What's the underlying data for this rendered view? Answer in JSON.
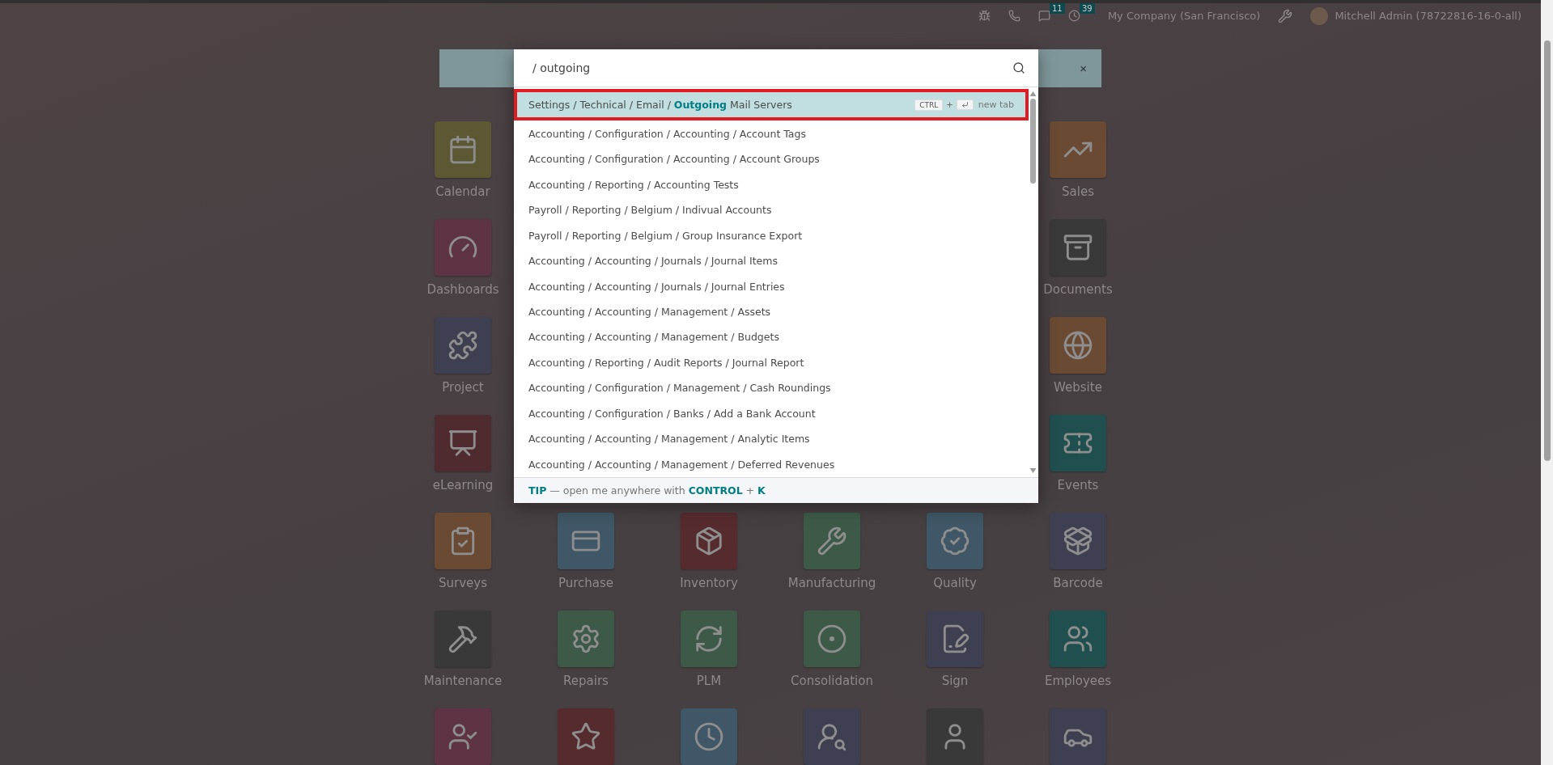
{
  "topbar": {
    "badges": [
      {
        "kind": "chat",
        "count": "11"
      },
      {
        "kind": "activity",
        "count": "39"
      }
    ],
    "company": "My Company (San Francisco)",
    "user": "Mitchell Admin (78722816-16-0-all)"
  },
  "banner": {
    "close": "×"
  },
  "app_rows": [
    [
      {
        "label": "Calendar",
        "kind": "calendar",
        "color": "#5d5834"
      },
      {
        "label": "Sales",
        "kind": "sales",
        "color": "#6b4a33"
      }
    ],
    [
      {
        "label": "Dashboards",
        "kind": "dashboards",
        "color": "#5e3343"
      },
      {
        "label": "Documents",
        "kind": "documents",
        "color": "#393939"
      }
    ],
    [
      {
        "label": "Project",
        "kind": "project",
        "color": "#3f3f52"
      },
      {
        "label": "Website",
        "kind": "website",
        "color": "#6b4a33"
      }
    ],
    [
      {
        "label": "eLearning",
        "kind": "elearning",
        "color": "#4f2a2e"
      },
      {
        "label": "Events",
        "kind": "events",
        "color": "#1f4f4f"
      }
    ],
    [
      {
        "label": "Surveys",
        "kind": "surveys",
        "color": "#6b4a33"
      },
      {
        "label": "Purchase",
        "kind": "purchase",
        "color": "#3f5766"
      },
      {
        "label": "Inventory",
        "kind": "inventory",
        "color": "#562b2e"
      },
      {
        "label": "Manufacturing",
        "kind": "manufacturing",
        "color": "#3d5a48"
      },
      {
        "label": "Quality",
        "kind": "quality",
        "color": "#3f5766"
      },
      {
        "label": "Barcode",
        "kind": "barcode",
        "color": "#3f3f52"
      }
    ],
    [
      {
        "label": "Maintenance",
        "kind": "maintenance",
        "color": "#393939"
      },
      {
        "label": "Repairs",
        "kind": "repairs",
        "color": "#3d5a48"
      },
      {
        "label": "PLM",
        "kind": "plm",
        "color": "#3d5a48"
      },
      {
        "label": "Consolidation",
        "kind": "consolidation",
        "color": "#3d5a48"
      },
      {
        "label": "Sign",
        "kind": "sign",
        "color": "#3f3f52"
      },
      {
        "label": "Employees",
        "kind": "employees",
        "color": "#1f4f4f"
      }
    ],
    [
      {
        "kind": "payroll",
        "color": "#5e3343"
      },
      {
        "kind": "appraisal",
        "color": "#562b2e"
      },
      {
        "kind": "attendance",
        "color": "#3f5766"
      },
      {
        "kind": "recruitment",
        "color": "#3f3f52"
      },
      {
        "kind": "referral",
        "color": "#393939"
      },
      {
        "kind": "fleet",
        "color": "#3f3f52"
      }
    ]
  ],
  "palette": {
    "search_value": "/ outgoing",
    "results": [
      {
        "text": "Settings / Technical / Email / **Outgoing** Mail Servers",
        "selected": true
      },
      {
        "text": "Accounting / Configuration / Accounting / Account Tags",
        "selected": false
      },
      {
        "text": "Accounting / Configuration / Accounting / Account Groups",
        "selected": false
      },
      {
        "text": "Accounting / Reporting / Accounting Tests",
        "selected": false
      },
      {
        "text": "Payroll / Reporting / Belgium / Indivual Accounts",
        "selected": false
      },
      {
        "text": "Payroll / Reporting / Belgium / Group Insurance Export",
        "selected": false
      },
      {
        "text": "Accounting / Accounting / Journals / Journal Items",
        "selected": false
      },
      {
        "text": "Accounting / Accounting / Journals / Journal Entries",
        "selected": false
      },
      {
        "text": "Accounting / Accounting / Management / Assets",
        "selected": false
      },
      {
        "text": "Accounting / Accounting / Management / Budgets",
        "selected": false
      },
      {
        "text": "Accounting / Reporting / Audit Reports / Journal Report",
        "selected": false
      },
      {
        "text": "Accounting / Configuration / Management / Cash Roundings",
        "selected": false
      },
      {
        "text": "Accounting / Configuration / Banks / Add a Bank Account",
        "selected": false
      },
      {
        "text": "Accounting / Accounting / Management / Analytic Items",
        "selected": false
      },
      {
        "text": "Accounting / Accounting / Management / Deferred Revenues",
        "selected": false
      }
    ],
    "hint": {
      "key": "CTRL",
      "plus": "+",
      "label": "new tab"
    },
    "tip": "**TIP** — open me anywhere with **CONTROL** + **K**"
  }
}
